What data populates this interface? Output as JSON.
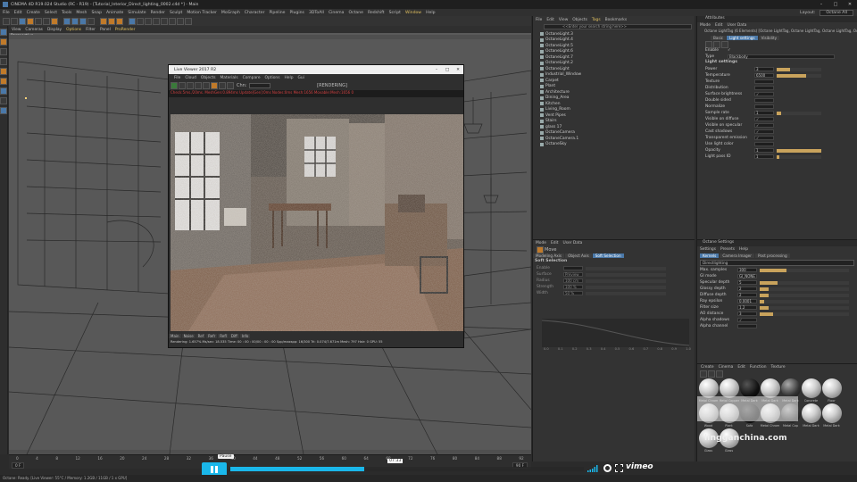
{
  "window": {
    "title": "CINEMA 4D R19.024 Studio (RC - R19) - [Tutorial_Interior_Direct_lighting_0002.c4d *] - Main",
    "layout_label": "Layout:",
    "layout_value": "Octane All"
  },
  "menubar": [
    "File",
    "Edit",
    "Create",
    "Select",
    "Tools",
    "Mesh",
    "Snap",
    "Animate",
    "Simulate",
    "Render",
    "Sculpt",
    "Motion Tracker",
    "MoGraph",
    "Character",
    "Pipeline",
    "Plugins",
    "3DToAll",
    "Cinema",
    "Octane",
    "Redshift",
    "Script",
    "Window",
    "Help"
  ],
  "viewport": {
    "menu": [
      "View",
      "Cameras",
      "Display",
      "Options",
      "Filter",
      "Panel",
      "ProRender"
    ],
    "label": "Perspective",
    "grid_spacing": "Grid Spacing : 100 cm"
  },
  "live_viewer": {
    "title": "Live Viewer 2017 R2",
    "menu": [
      "File",
      "Cloud",
      "Objects",
      "Materials",
      "Compare",
      "Options",
      "Help",
      "Gui"
    ],
    "status": "[RENDERING]",
    "chn_label": "Chn:",
    "info_line": "Check:5ms./20ms. MeshGen:0.894ms Update[Gen]:0ms Nodes:0ms Mesh:1656 Movable:Mesh:1656 0",
    "tabs": [
      "Main",
      "Noise",
      "Ref",
      "Refr",
      "Refl",
      "Diff",
      "Info"
    ],
    "footer": "Rendering: 1.657%   Ms/sec: 18.535   Time: 00 : 00 : 00/00 : 00 : 00   Spp/maxspp: 16/300   Tri: 0.074/7.671m   Mesh: 797   Hair: 0   GPU: 55"
  },
  "object_manager": {
    "menu": [
      "File",
      "Edit",
      "View",
      "Objects",
      "Tags",
      "Bookmarks"
    ],
    "search_placeholder": "<<Enter your search string here>>",
    "items": [
      "OctaneLight.3",
      "OctaneLight.4",
      "OctaneLight.5",
      "OctaneLight.6",
      "OctaneLight.7",
      "OctaneLight.2",
      "OctaneLight",
      "Industrial_Window",
      "Carpet",
      "Plant",
      "Architecture",
      "Dining_Area",
      "Kitchen",
      "Living_Room",
      "Vent Pipes",
      "Stairs",
      "glass 17",
      "OctaneCamera",
      "OctaneCamera.1",
      "OctaneSky"
    ]
  },
  "attributes": {
    "header": "Attributes",
    "menu": [
      "Mode",
      "Edit",
      "User Data"
    ],
    "object_line": "Octane LightTag (6 Elements) [Octane LightTag, Octane LightTag, Octane LightTag, Octane LightTag...]",
    "tabs": [
      "Basic",
      "Light settings",
      "Visibility"
    ],
    "rows": [
      {
        "label": "Enable",
        "value": "✓"
      },
      {
        "label": "Type",
        "value": "Blackbody"
      }
    ],
    "section": "Light settings",
    "settings": [
      {
        "label": "Power",
        "value": "3",
        "level": 0.3
      },
      {
        "label": "Temperature",
        "value": "6500",
        "level": 0.65
      },
      {
        "label": "Texture",
        "value": "",
        "level": 0
      },
      {
        "label": "Distribution",
        "value": "",
        "level": 0
      },
      {
        "label": "Surface brightness",
        "value": "✓",
        "level": 0
      },
      {
        "label": "Double sided",
        "value": "",
        "level": 0
      },
      {
        "label": "Normalize",
        "value": "",
        "level": 0
      },
      {
        "label": "Sample rate",
        "value": "1",
        "level": 0.1
      },
      {
        "label": "Visible on diffuse",
        "value": "✓",
        "level": 0
      },
      {
        "label": "Visible on specular",
        "value": "✓",
        "level": 0
      },
      {
        "label": "Cast shadows",
        "value": "✓",
        "level": 0
      },
      {
        "label": "Transparent emission",
        "value": "✓",
        "level": 0
      },
      {
        "label": "Use light color",
        "value": "",
        "level": 0
      },
      {
        "label": "Opacity",
        "value": "1",
        "level": 1
      },
      {
        "label": "Light pass ID",
        "value": "1",
        "level": 0.05
      }
    ]
  },
  "modeling": {
    "header": "Mode",
    "menu": [
      "Mode",
      "Edit",
      "User Data"
    ],
    "move_label": "Move",
    "tabs": [
      "Modeling Axis",
      "Object Axis",
      "Soft Selection"
    ],
    "section": "Soft Selection",
    "rows": [
      {
        "label": "Enable",
        "value": ""
      },
      {
        "label": "Surface",
        "value": "Preview"
      },
      {
        "label": "Radius",
        "value": "100 cm"
      },
      {
        "label": "Strength",
        "value": "100 %"
      },
      {
        "label": "Width",
        "value": "50 %"
      }
    ],
    "graph_ticks": [
      "0.0",
      "0.1",
      "0.2",
      "0.3",
      "0.4",
      "0.5",
      "0.6",
      "0.7",
      "0.8",
      "0.9",
      "1.0"
    ]
  },
  "octane_settings": {
    "header": "Octane Settings",
    "menu": [
      "Settings",
      "Presets",
      "Help"
    ],
    "tabs": [
      "Kernels",
      "Camera Imager",
      "Post processing"
    ],
    "kernel": "Directlighting",
    "rows": [
      {
        "label": "Max. samples",
        "value": "300",
        "level": 0.3
      },
      {
        "label": "GI mode",
        "value": "GI_NONE",
        "level": 0
      },
      {
        "label": "Specular depth",
        "value": "5",
        "level": 0.2
      },
      {
        "label": "Glossy depth",
        "value": "2",
        "level": 0.1
      },
      {
        "label": "Diffuse depth",
        "value": "2",
        "level": 0.1
      },
      {
        "label": "Ray epsilon",
        "value": "0.0001",
        "level": 0.05
      },
      {
        "label": "Filter size",
        "value": "1.2",
        "level": 0.1
      },
      {
        "label": "AO distance",
        "value": "3",
        "level": 0.15
      },
      {
        "label": "Alpha shadows",
        "value": "✓",
        "level": 0
      },
      {
        "label": "Alpha channel",
        "value": "",
        "level": 0
      }
    ]
  },
  "material_manager": {
    "menu": [
      "Create",
      "Cinema",
      "Edit",
      "Function",
      "Texture"
    ],
    "materials": [
      "Metal Chrom",
      "Metal Copper",
      "Metal Dark",
      "Metal Dark",
      "Metal Dark",
      "Concrete",
      "Floor",
      "Wood",
      "Plant",
      "Sofa",
      "Metal Chrom",
      "Metal Cop",
      "Metal Dark",
      "Metal Dark",
      "Glass",
      "Glass"
    ]
  },
  "timeline": {
    "ticks": [
      "0",
      "4",
      "8",
      "12",
      "16",
      "20",
      "24",
      "28",
      "32",
      "36",
      "40",
      "44",
      "48",
      "52",
      "56",
      "60",
      "64",
      "68",
      "72",
      "76",
      "80",
      "84",
      "88",
      "92"
    ],
    "frame_start": "0 F",
    "frame_end": "90 F"
  },
  "video_player": {
    "pause_tooltip": "Pause",
    "time": "07:33",
    "progress": 0.38,
    "brand": "vimeo",
    "watermark_url": "lingganchina.com"
  },
  "statusbar": "Octane:  Ready.  [Live Viewer: 55°C  /  Memory: 1.2GB / 11GB  /  1 x GPU]"
}
